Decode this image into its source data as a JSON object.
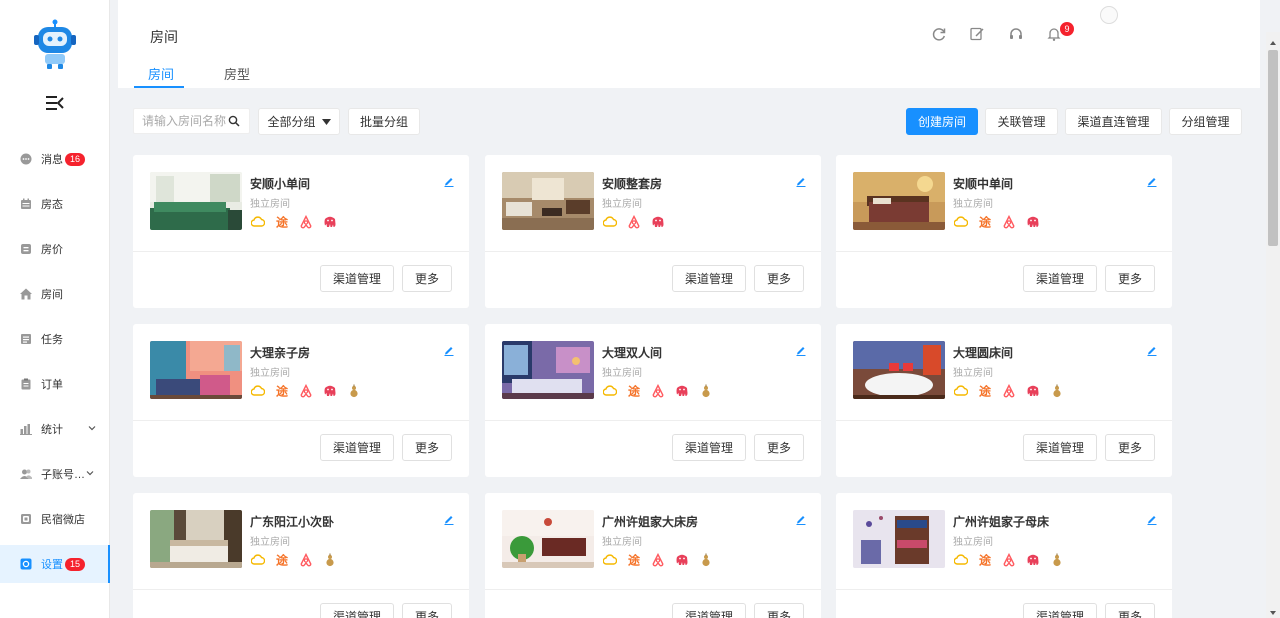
{
  "sidebar": {
    "items": [
      {
        "label": "消息",
        "icon": "message-icon",
        "badge": "16",
        "name": "sidebar-item-messages"
      },
      {
        "label": "房态",
        "icon": "calendar-icon",
        "badge": null,
        "name": "sidebar-item-room-status"
      },
      {
        "label": "房价",
        "icon": "price-tag-icon",
        "badge": null,
        "name": "sidebar-item-room-price"
      },
      {
        "label": "房间",
        "icon": "house-icon",
        "badge": null,
        "name": "sidebar-item-rooms"
      },
      {
        "label": "任务",
        "icon": "checklist-icon",
        "badge": null,
        "name": "sidebar-item-tasks"
      },
      {
        "label": "订单",
        "icon": "clipboard-icon",
        "badge": null,
        "name": "sidebar-item-orders"
      },
      {
        "label": "统计",
        "icon": "bar-chart-icon",
        "badge": null,
        "name": "sidebar-item-statistics",
        "caret": true
      },
      {
        "label": "子账号…",
        "icon": "users-icon",
        "badge": null,
        "name": "sidebar-item-sub-accounts",
        "caret": true
      },
      {
        "label": "民宿微店",
        "icon": "shop-icon",
        "badge": null,
        "name": "sidebar-item-micro-shop"
      },
      {
        "label": "设置",
        "icon": "settings-icon",
        "badge": "15",
        "name": "sidebar-item-settings",
        "active": true
      }
    ]
  },
  "header": {
    "title": "房间",
    "tabs": [
      {
        "label": "房间",
        "active": true
      },
      {
        "label": "房型",
        "active": false
      }
    ],
    "icons": [
      "refresh-icon",
      "edit-note-icon",
      "headset-icon",
      "bell-icon"
    ],
    "notification_count": "9"
  },
  "toolbar": {
    "search_placeholder": "请输入房间名称",
    "group_select": "全部分组",
    "batch_group": "批量分组",
    "create_room": "创建房间",
    "link_manage": "关联管理",
    "channel_direct": "渠道直连管理",
    "group_manage": "分组管理"
  },
  "card_labels": {
    "manage": "渠道管理",
    "more": "更多"
  },
  "rooms": [
    {
      "name": "安顺小单间",
      "type": "独立房间",
      "channels": [
        "cloud-icon",
        "tu-icon",
        "airbnb-icon",
        "elephant-icon"
      ],
      "photo": "green-bed"
    },
    {
      "name": "安顺整套房",
      "type": "独立房间",
      "channels": [
        "cloud-icon",
        "airbnb-icon",
        "elephant-icon"
      ],
      "photo": "living-room"
    },
    {
      "name": "安顺中单间",
      "type": "独立房间",
      "channels": [
        "cloud-icon",
        "tu-icon",
        "airbnb-icon",
        "elephant-icon"
      ],
      "photo": "warm-bedroom"
    },
    {
      "name": "大理亲子房",
      "type": "独立房间",
      "channels": [
        "cloud-icon",
        "tu-icon",
        "airbnb-icon",
        "elephant-icon",
        "gourd-icon"
      ],
      "photo": "pink-room"
    },
    {
      "name": "大理双人间",
      "type": "独立房间",
      "channels": [
        "cloud-icon",
        "tu-icon",
        "airbnb-icon",
        "elephant-icon",
        "gourd-icon"
      ],
      "photo": "purple-room"
    },
    {
      "name": "大理圆床间",
      "type": "独立房间",
      "channels": [
        "cloud-icon",
        "tu-icon",
        "airbnb-icon",
        "elephant-icon",
        "gourd-icon"
      ],
      "photo": "round-bed"
    },
    {
      "name": "广东阳江小次卧",
      "type": "独立房间",
      "channels": [
        "cloud-icon",
        "tu-icon",
        "airbnb-icon",
        "gourd-icon"
      ],
      "photo": "window-bed"
    },
    {
      "name": "广州许姐家大床房",
      "type": "独立房间",
      "channels": [
        "cloud-icon",
        "tu-icon",
        "airbnb-icon",
        "elephant-icon",
        "gourd-icon"
      ],
      "photo": "plant-room"
    },
    {
      "name": "广州许姐家子母床",
      "type": "独立房间",
      "channels": [
        "cloud-icon",
        "tu-icon",
        "airbnb-icon",
        "elephant-icon",
        "gourd-icon"
      ],
      "photo": "bunk-room"
    }
  ],
  "colors": {
    "accent": "#1890ff",
    "badge": "#f5222d",
    "cloud": "#f5b800",
    "tu": "#f5742a",
    "airbnb": "#ff5a5f",
    "elephant": "#e8405a",
    "gourd": "#c89a4c"
  }
}
